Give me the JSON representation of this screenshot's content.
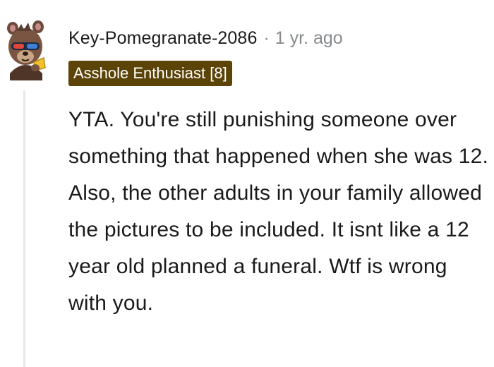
{
  "comment": {
    "author": "Key-Pomegranate-2086",
    "separator": "·",
    "timestamp": "1 yr. ago",
    "flair": "Asshole Enthusiast [8]",
    "body": "YTA. You're still punishing someone over something that happened when she was 12. Also, the other adults in your family allowed the pictures to be included. It isnt like a 12 year old planned a funeral. Wtf is wrong with you.",
    "avatar_icon": "cartoon-avatar-icon"
  },
  "colors": {
    "flair_background": "#5c4408",
    "flair_text": "#ffffff",
    "username": "#1c1c1c",
    "timestamp": "#878a8c",
    "body_text": "#1a1a1b",
    "thread_line": "#e9e9e9"
  }
}
